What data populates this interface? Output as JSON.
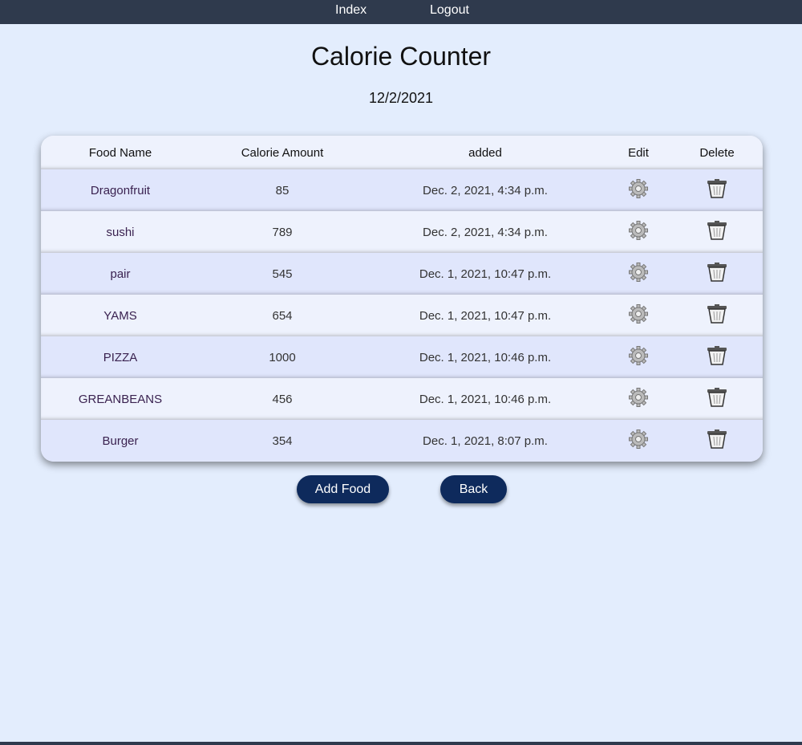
{
  "nav": {
    "index": "Index",
    "logout": "Logout"
  },
  "title": "Calorie Counter",
  "date": "12/2/2021",
  "table": {
    "headers": [
      "Food Name",
      "Calorie Amount",
      "added",
      "Edit",
      "Delete"
    ],
    "rows": [
      {
        "name": "Dragonfruit",
        "calories": "85",
        "added": "Dec. 2, 2021, 4:34 p.m."
      },
      {
        "name": "sushi",
        "calories": "789",
        "added": "Dec. 2, 2021, 4:34 p.m."
      },
      {
        "name": "pair",
        "calories": "545",
        "added": "Dec. 1, 2021, 10:47 p.m."
      },
      {
        "name": "YAMS",
        "calories": "654",
        "added": "Dec. 1, 2021, 10:47 p.m."
      },
      {
        "name": "PIZZA",
        "calories": "1000",
        "added": "Dec. 1, 2021, 10:46 p.m."
      },
      {
        "name": "GREANBEANS",
        "calories": "456",
        "added": "Dec. 1, 2021, 10:46 p.m."
      },
      {
        "name": "Burger",
        "calories": "354",
        "added": "Dec. 1, 2021, 8:07 p.m."
      }
    ]
  },
  "buttons": {
    "add": "Add Food",
    "back": "Back"
  }
}
